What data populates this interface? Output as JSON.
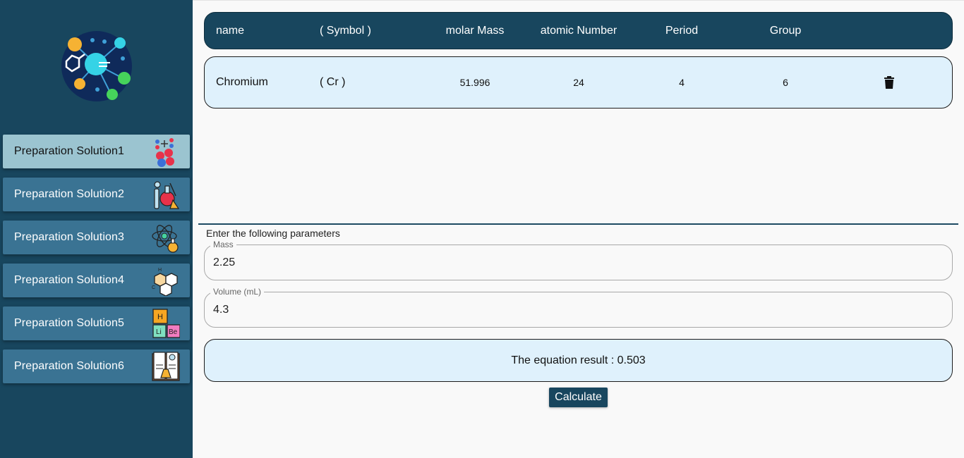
{
  "sidebar": {
    "logo_icon": "atom-molecule-logo-icon",
    "items": [
      {
        "label": "Preparation Solution1",
        "icon": "molecules-icon",
        "active": true
      },
      {
        "label": "Preparation Solution2",
        "icon": "lab-equipment-icon",
        "active": false
      },
      {
        "label": "Preparation Solution3",
        "icon": "atom-flask-icon",
        "active": false
      },
      {
        "label": "Preparation Solution4",
        "icon": "benzene-ring-icon",
        "active": false
      },
      {
        "label": "Preparation Solution5",
        "icon": "periodic-elements-icon",
        "active": false
      },
      {
        "label": "Preparation Solution6",
        "icon": "chemistry-book-icon",
        "active": false
      }
    ]
  },
  "table": {
    "headers": {
      "name": "name",
      "symbol": "( Symbol )",
      "molar_mass": "molar Mass",
      "atomic_number": "atomic Number",
      "period": "Period",
      "group": "Group"
    },
    "row": {
      "name": "Chromium",
      "symbol": "( Cr )",
      "molar_mass": "51.996",
      "atomic_number": "24",
      "period": "4",
      "group": "6",
      "delete_icon": "trash-icon"
    }
  },
  "form": {
    "instruction": "Enter the following parameters",
    "mass": {
      "label": "Mass",
      "value": "2.25"
    },
    "volume": {
      "label": "Volume (mL)",
      "value": "4.3"
    }
  },
  "result": {
    "text": "The equation result : 0.503"
  },
  "calculate_label": "Calculate",
  "colors": {
    "sidebar_bg": "#18465e",
    "nav_item_bg": "#3a7393",
    "nav_item_active_bg": "#9bc4d0",
    "row_bg": "#dff1fc",
    "accent": "#18465e"
  }
}
